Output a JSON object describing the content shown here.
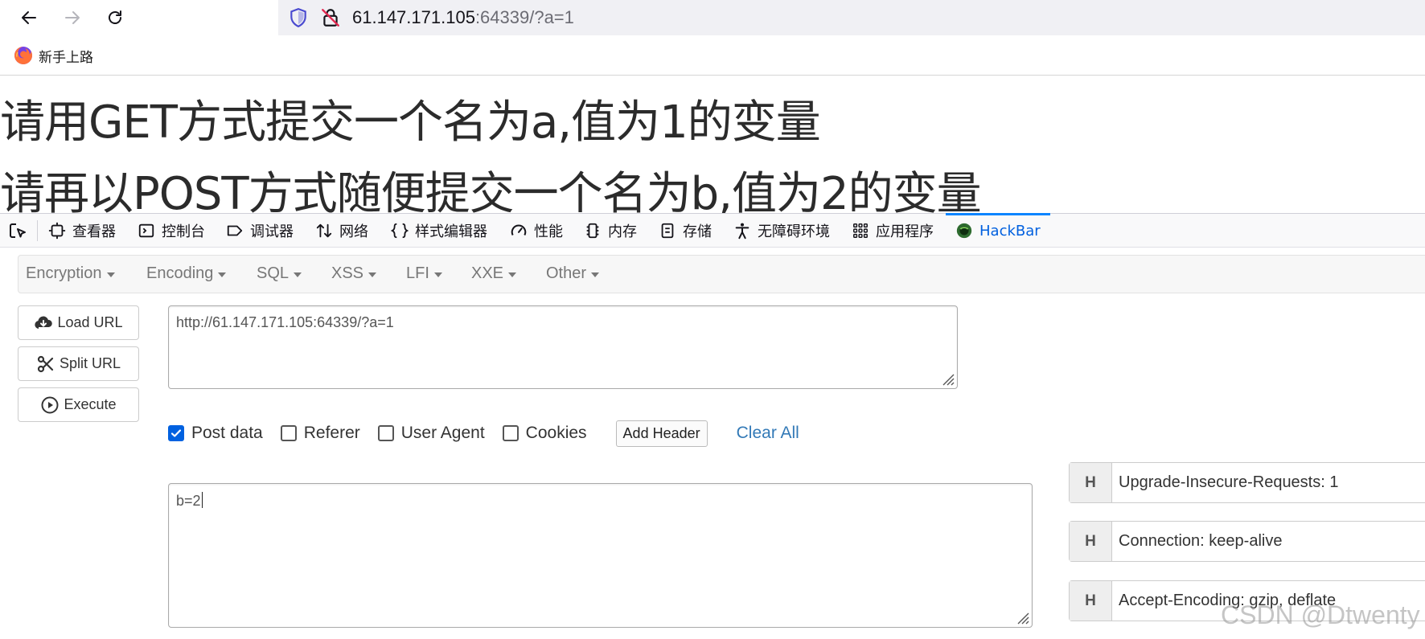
{
  "browser": {
    "url_host": "61.147.171.105",
    "url_rest": ":64339/?a=1",
    "bookmark_label": "新手上路"
  },
  "page": {
    "heading_1": "请用GET方式提交一个名为a,值为1的变量",
    "heading_2": "请再以POST方式随便提交一个名为b,值为2的变量"
  },
  "devtools": {
    "tabs": [
      "查看器",
      "控制台",
      "调试器",
      "网络",
      "样式编辑器",
      "性能",
      "内存",
      "存储",
      "无障碍环境",
      "应用程序",
      "HackBar"
    ],
    "active_tab": "HackBar",
    "accent_color": "#0a84ff"
  },
  "hackbar": {
    "menus": [
      "Encryption",
      "Encoding",
      "SQL",
      "XSS",
      "LFI",
      "XXE",
      "Other"
    ],
    "buttons": {
      "load_url": "Load URL",
      "split_url": "Split URL",
      "execute": "Execute"
    },
    "url_value": "http://61.147.171.105:64339/?a=1",
    "options": {
      "post_data": "Post data",
      "post_data_checked": true,
      "referer": "Referer",
      "user_agent": "User Agent",
      "cookies": "Cookies",
      "add_header": "Add Header",
      "clear_all": "Clear All"
    },
    "post_value": "b=2",
    "header_tag": "H",
    "headers": [
      "Upgrade-Insecure-Requests: 1",
      "Connection: keep-alive",
      "Accept-Encoding: gzip, deflate"
    ]
  },
  "watermark": "CSDN @Dtwenty"
}
